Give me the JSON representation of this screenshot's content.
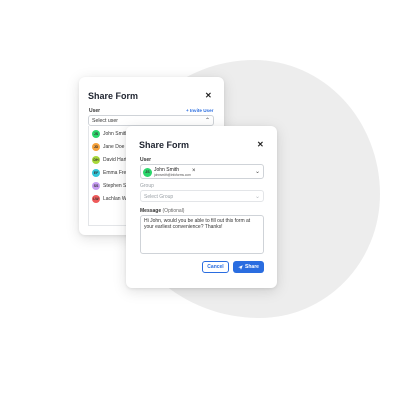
{
  "back_dialog": {
    "title": "Share Form",
    "close_glyph": "✕",
    "user_label": "User",
    "invite_link": "+ Invite User",
    "user_select_text": "Select user",
    "user_list": [
      {
        "initials": "JS",
        "name": "John Smith",
        "color": "#2bd66b"
      },
      {
        "initials": "JD",
        "name": "Jane Doe",
        "color": "#f7a23b"
      },
      {
        "initials": "DH",
        "name": "David Hart",
        "color": "#a8d83a"
      },
      {
        "initials": "EF",
        "name": "Emma Fred",
        "color": "#32c6d9"
      },
      {
        "initials": "SS",
        "name": "Stephen So",
        "color": "#c69cf2"
      },
      {
        "initials": "LW",
        "name": "Lachlan We",
        "color": "#ee5a5a"
      }
    ]
  },
  "front_dialog": {
    "title": "Share Form",
    "close_glyph": "✕",
    "user_label": "User",
    "selected_user": {
      "initials": "JS",
      "name": "John Smith",
      "email": "johnsmith@infoforms.com",
      "color": "#2bd66b",
      "remove_glyph": "×"
    },
    "group_label": "Group",
    "group_placeholder": "Select Group",
    "message_label": "Message",
    "message_optional": "(Optional)",
    "message_text": "Hi John, would you be able to fill out this form at your earliest convenience? Thanks!",
    "cancel_label": "Cancel",
    "share_label": "Share"
  },
  "colors": {
    "accent": "#2a6de0",
    "blob": "#ededed"
  }
}
